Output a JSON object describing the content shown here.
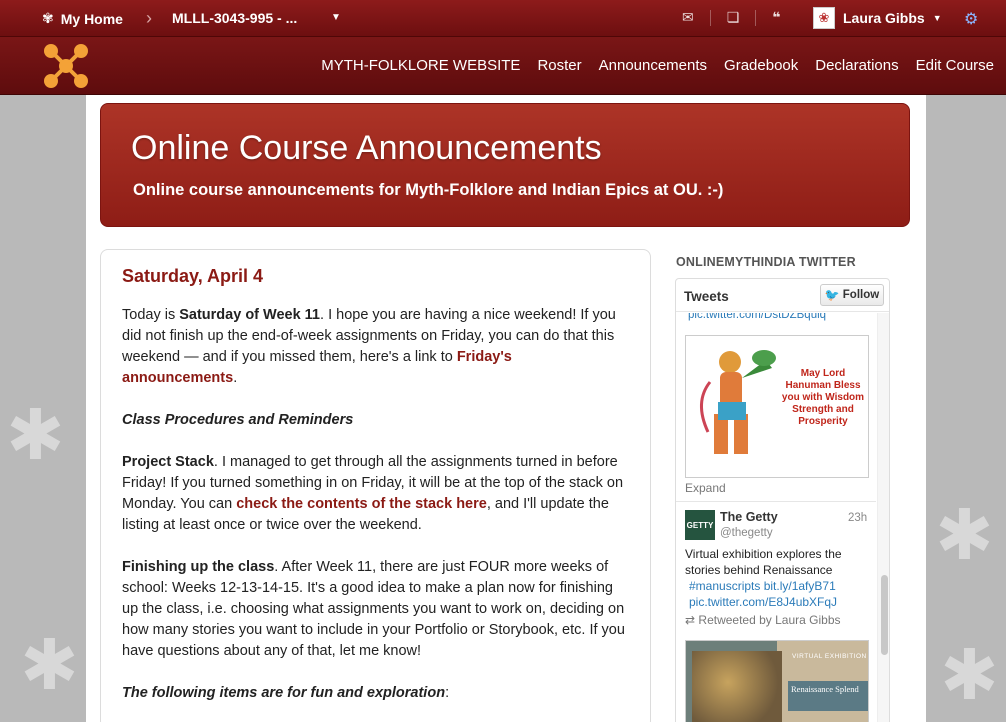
{
  "topbar": {
    "home_label": "My Home",
    "course_label": "MLLL-3043-995 - ...",
    "user_name": "Laura Gibbs"
  },
  "nav": {
    "items": [
      "MYTH-FOLKLORE WEBSITE",
      "Roster",
      "Announcements",
      "Gradebook",
      "Declarations",
      "Edit Course"
    ]
  },
  "banner": {
    "title": "Online Course Announcements",
    "subtitle": "Online course announcements for Myth-Folklore and Indian Epics at OU. :-)"
  },
  "post": {
    "date": "Saturday, April 4",
    "p1": {
      "a": "Today is ",
      "b": "Saturday of Week 11",
      "c": ". I hope you are having a nice weekend! If you did not finish up the end-of-week assignments on Friday, you can do that this weekend — and if you missed them, here's a link to ",
      "link": "Friday's announcements",
      "d": "."
    },
    "section_heading": "Class Procedures and Reminders",
    "p2": {
      "b": "Project Stack",
      "c": ". I managed to get through all the assignments turned in before Friday! If you turned something in on Friday, it will be at the top of the stack on Monday. You can ",
      "link": "check the contents of the stack here",
      "d": ", and I'll update the listing at least once or twice over the weekend."
    },
    "p3": {
      "b": "Finishing up the class",
      "c": ". After Week 11, there are just FOUR more weeks of school: Weeks 12-13-14-15. It's a good idea to make a plan now for finishing up the class, i.e. choosing what assignments you want to work on, deciding on how many stories you want to include in your Portfolio or Storybook, etc. If you have questions about any of that, let me know!"
    },
    "p4": {
      "i": "The following items are for fun and exploration",
      "c": ":"
    }
  },
  "sidebar": {
    "title": "ONLINEMYTHINDIA TWITTER",
    "tweets_label": "Tweets",
    "follow_label": "Follow",
    "link_top": "pic.twitter.com/DstDZBquiq",
    "hanuman_text": "May Lord Hanuman Bless you with Wisdom Strength and Prosperity",
    "expand_label": "Expand",
    "getty": {
      "name": "The Getty",
      "handle": "@thegetty",
      "time": "23h",
      "text": "Virtual exhibition explores the stories behind Renaissance",
      "hashtag_link": "#manuscripts bit.ly/1afyB71",
      "pic_link": "pic.twitter.com/E8J4ubXFqJ",
      "retweet": "Retweeted by Laura Gibbs"
    },
    "exhibit": {
      "tag": "VIRTUAL EXHIBITION",
      "title": "Renaissance Splend"
    }
  },
  "colors": {
    "topbar": "#7d1414",
    "banner": "#9e2a1f",
    "link": "#8b1a14",
    "twitter_link": "#2b7bb9"
  }
}
